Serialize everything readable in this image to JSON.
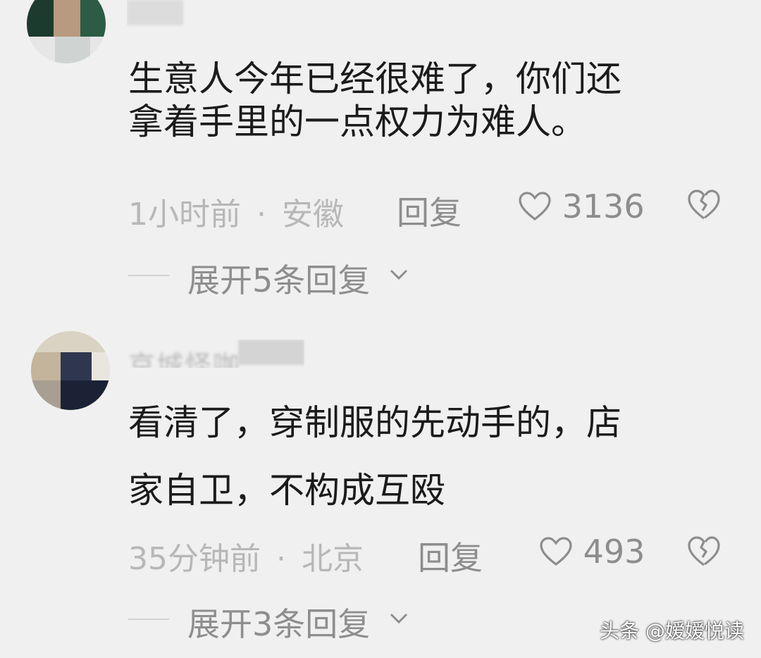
{
  "comments": [
    {
      "text_line1": "生意人今年已经很难了，你们还",
      "text_line2": "拿着手里的一点权力为难人。",
      "time": "1小时前",
      "dot": "·",
      "location": "安徽",
      "reply_label": "回复",
      "like_count": "3136",
      "expand_label": "展开5条回复"
    },
    {
      "username_partial": "京城怪咖",
      "text_line1": "看清了，穿制服的先动手的，店",
      "text_line2": "家自卫，不构成互殴",
      "time": "35分钟前",
      "dot": "·",
      "location": "北京",
      "reply_label": "回复",
      "like_count": "493",
      "expand_label": "展开3条回复"
    }
  ],
  "watermark": "头条 @嫒嫒悦读",
  "icons": {
    "like": "heart-outline-icon",
    "dislike": "broken-heart-icon",
    "expand": "chevron-down-icon"
  },
  "colors": {
    "background": "#f0f0f0",
    "text": "#1b1b1b",
    "meta": "#b7b7b7",
    "action": "#8d8d8d"
  }
}
